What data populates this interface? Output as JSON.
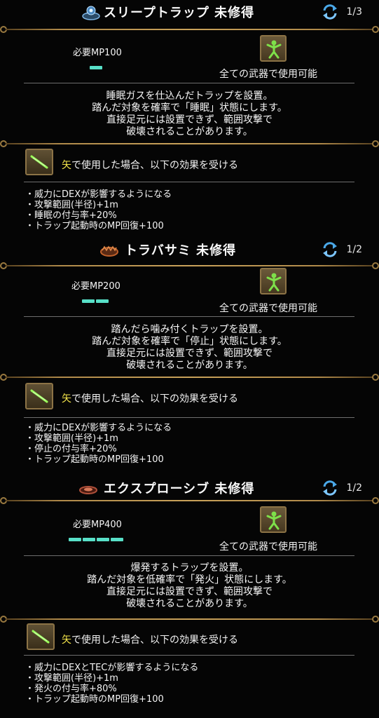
{
  "skills": [
    {
      "title": "スリープトラップ 未修得",
      "icon": "sleep-trap-icon",
      "page": "1/3",
      "mp": "必要MP100",
      "mp_pips": 1,
      "weapon": "全ての武器で使用可能",
      "description": [
        "睡眠ガスを仕込んだトラップを設置。",
        "踏んだ対象を確率で「睡眠」状態にします。",
        "直接足元には設置できず、範囲攻撃で",
        "破壊されることがあります。"
      ],
      "condition_highlight": "矢",
      "condition_rest": "で使用した場合、以下の効果を受ける",
      "effects": [
        "・威力にDEXが影響するようになる",
        "・攻撃範囲(半径)+1m",
        "・睡眠の付与率+20%",
        "・トラップ起動時のMP回復+100"
      ]
    },
    {
      "title": "トラバサミ 未修得",
      "icon": "bear-trap-icon",
      "page": "1/2",
      "mp": "必要MP200",
      "mp_pips": 2,
      "weapon": "全ての武器で使用可能",
      "description": [
        "踏んだら噛み付くトラップを設置。",
        "踏んだ対象を確率で「停止」状態にします。",
        "直接足元には設置できず、範囲攻撃で",
        "破壊されることがあります。"
      ],
      "condition_highlight": "矢",
      "condition_rest": "で使用した場合、以下の効果を受ける",
      "effects": [
        "・威力にDEXが影響するようになる",
        "・攻撃範囲(半径)+1m",
        "・停止の付与率+20%",
        "・トラップ起動時のMP回復+100"
      ]
    },
    {
      "title": "エクスプローシブ 未修得",
      "icon": "explosive-trap-icon",
      "page": "1/2",
      "mp": "必要MP400",
      "mp_pips": 4,
      "weapon": "全ての武器で使用可能",
      "description": [
        "爆発するトラップを設置。",
        "踏んだ対象を低確率で「発火」状態にします。",
        "直接足元には設置できず、範囲攻撃で",
        "破壊されることがあります。"
      ],
      "condition_highlight": "矢",
      "condition_rest": "で使用した場合、以下の効果を受ける",
      "effects": [
        "・威力にDEXとTECが影響するようになる",
        "・攻撃範囲(半径)+1m",
        "・発火の付与率+80%",
        "・トラップ起動時のMP回復+100"
      ]
    }
  ],
  "colors": {
    "accent_mp": "#58e0c8",
    "highlight": "#f1e24a",
    "divider_gold": "#c9a25a",
    "weapon_green": "#7ee04a"
  }
}
